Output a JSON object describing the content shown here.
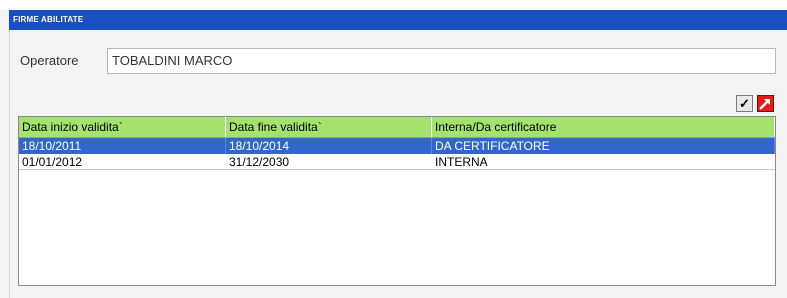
{
  "window": {
    "title": "FIRME ABILITATE"
  },
  "operator": {
    "label": "Operatore",
    "value": "TOBALDINI MARCO"
  },
  "toolbar": {
    "confirm_icon": "checkmark-icon",
    "exit_icon": "exit-arrow-icon"
  },
  "table": {
    "columns": [
      "Data inizio validita`",
      "Data fine validita`",
      "Interna/Da certificatore"
    ],
    "rows": [
      [
        "18/10/2011",
        "18/10/2014",
        "DA CERTIFICATORE"
      ],
      [
        "01/01/2012",
        "31/12/2030",
        "INTERNA"
      ]
    ],
    "selected_row": 0
  },
  "colors": {
    "title_bar": "#1a4fbf",
    "header_green": "#a3e26f",
    "selection_blue": "#3366cc",
    "exit_red": "#e31b1b"
  }
}
